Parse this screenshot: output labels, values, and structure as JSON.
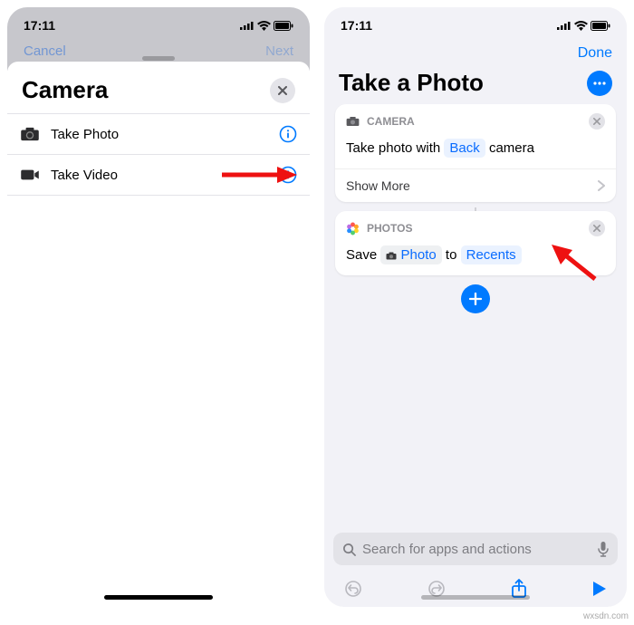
{
  "left": {
    "status_time": "17:11",
    "nav_left": "Cancel",
    "nav_right": "Next",
    "sheet_title": "Camera",
    "rows": [
      {
        "label": "Take Photo"
      },
      {
        "label": "Take Video"
      }
    ]
  },
  "right": {
    "status_time": "17:11",
    "done": "Done",
    "page_title": "Take a Photo",
    "card1": {
      "section": "CAMERA",
      "text_pre": "Take photo with",
      "token": "Back",
      "text_post": "camera",
      "show_more": "Show More"
    },
    "card2": {
      "section": "PHOTOS",
      "save_word": "Save",
      "photo_token": "Photo",
      "to_word": "to",
      "recents_token": "Recents"
    },
    "search_placeholder": "Search for apps and actions"
  },
  "watermark": "wxsdn.com"
}
